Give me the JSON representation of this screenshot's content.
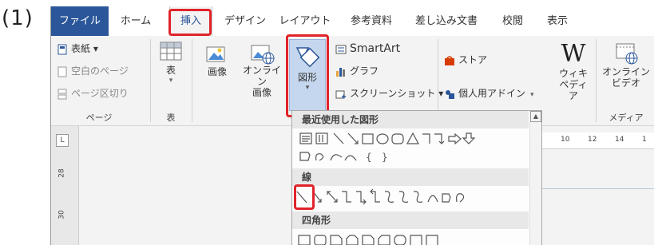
{
  "step_label": "(1)",
  "tabs": [
    {
      "label": "ファイル"
    },
    {
      "label": "ホーム"
    },
    {
      "label": "挿入"
    },
    {
      "label": "デザイン"
    },
    {
      "label": "レイアウト"
    },
    {
      "label": "参考資料"
    },
    {
      "label": "差し込み文書"
    },
    {
      "label": "校閲"
    },
    {
      "label": "表示"
    }
  ],
  "ribbon": {
    "pages": {
      "cover": "表紙 ▾",
      "blank": "空白のページ",
      "break": "ページ区切り",
      "group": "ページ"
    },
    "table": {
      "button": "表",
      "group": "表"
    },
    "images": {
      "picture": "画像",
      "online_line1": "オンライン",
      "online_line2": "画像"
    },
    "shapes": {
      "label": "図形"
    },
    "smartart": "SmartArt",
    "chart": "グラフ",
    "screenshot": "スクリーンショット ▾",
    "store": "ストア",
    "addins": "個人用アドイン",
    "wiki_line1": "ウィキ",
    "wiki_line2": "ペディア",
    "online_video_line1": "オンライン",
    "online_video_line2": "ビデオ",
    "media_group": "メディア"
  },
  "dropdown": {
    "recent_header": "最近使用した図形",
    "lines_header": "線",
    "rect_header": "四角形"
  },
  "ruler": {
    "corner": "L",
    "v_marks": [
      "28",
      "30"
    ],
    "h_marks": [
      "10",
      "12",
      "14",
      "1"
    ]
  },
  "colors": {
    "highlight": "#e0242a",
    "file_tab": "#2b579a",
    "shapes_selected": "#c5d7ee"
  }
}
